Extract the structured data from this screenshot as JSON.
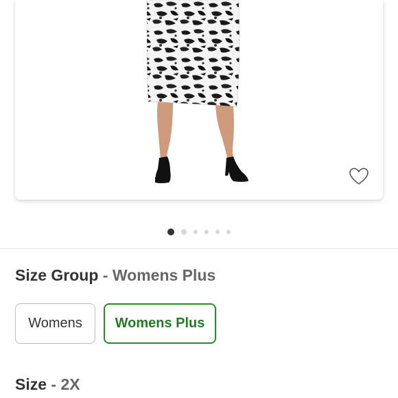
{
  "product": {
    "image_alt": "Model wearing black and white animal print pencil skirt with black pumps",
    "favorite_icon": "heart-outline-icon"
  },
  "carousel": {
    "total": 6,
    "active_index": 0
  },
  "size_group": {
    "label": "Size Group",
    "separator": "-",
    "selected_value": "Womens Plus",
    "options": [
      {
        "label": "Womens",
        "selected": false
      },
      {
        "label": "Womens Plus",
        "selected": true
      }
    ]
  },
  "size": {
    "label": "Size",
    "separator": "-",
    "selected_value": "2X"
  },
  "colors": {
    "selected_green": "#237b23",
    "text_dark": "#333333",
    "text_muted": "#666666"
  }
}
